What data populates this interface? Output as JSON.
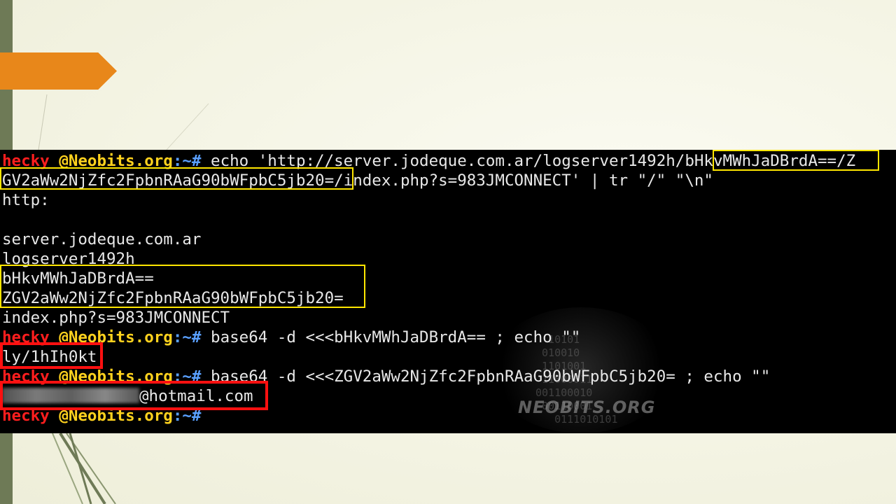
{
  "prompt": {
    "user": "hecky",
    "host": "@Neobits.org",
    "path": ":~#"
  },
  "terminal": {
    "lines": [
      {
        "command": " echo 'http://server.jodeque.com.ar/logserver1492h/bHkvMWhJaDBrdA==/Z"
      },
      {
        "text": "GV2aWw2NjZfc2FpbnRAaG90bWFpbC5jb20=/index.php?s=983JMCONNECT' | tr \"/\" \"\\n\""
      },
      {
        "text": "http:"
      },
      {
        "text": ""
      },
      {
        "text": "server.jodeque.com.ar"
      },
      {
        "text": "logserver1492h"
      },
      {
        "text": "bHkvMWhJaDBrdA=="
      },
      {
        "text": "ZGV2aWw2NjZfc2FpbnRAaG90bWFpbC5jb20="
      },
      {
        "text": "index.php?s=983JMCONNECT"
      },
      {
        "command": " base64 -d <<<bHkvMWhJaDBrdA== ; echo \"\""
      },
      {
        "text": "ly/1hIh0kt"
      },
      {
        "command": " base64 -d <<<ZGV2aWw2NjZfc2FpbnRAaG90bWFpbC5jb20= ; echo \"\""
      },
      {
        "email_suffix": "@hotmail.com"
      },
      {
        "command": ""
      }
    ]
  },
  "watermark": {
    "text": "NEOBITS.ORG",
    "bits": "  10101\n 010010\n 1101001\n 11000011\n001100010\n 00110001\n   0111010101"
  },
  "colors": {
    "accent_orange": "#e8871a",
    "left_bar": "#6e7a56",
    "highlight_yellow": "#ffe600",
    "highlight_red": "#ff1010",
    "prompt_user": "#ff1e1e",
    "prompt_host": "#ffd21e"
  }
}
